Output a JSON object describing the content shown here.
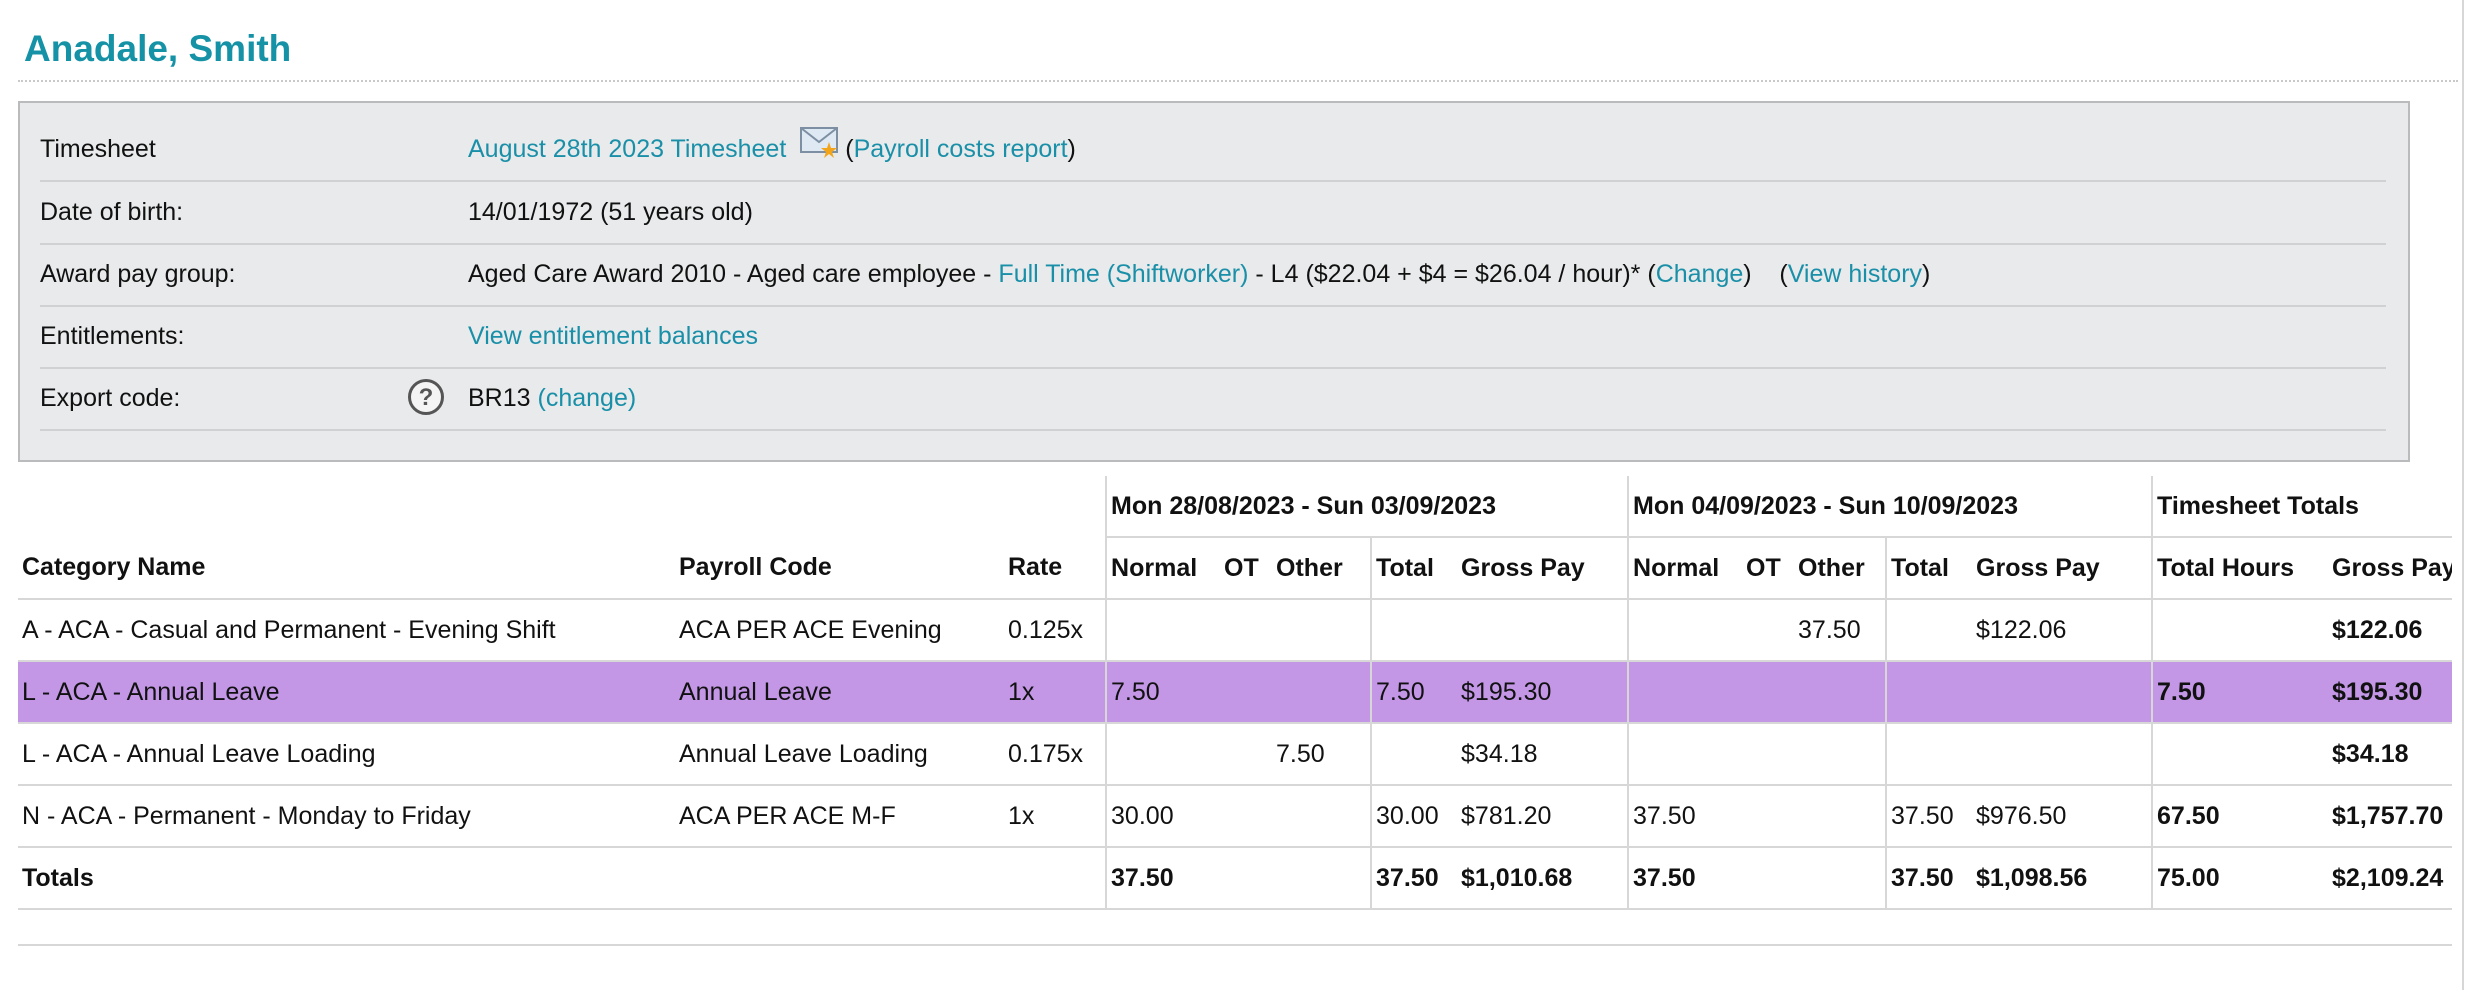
{
  "employee": {
    "name": "Anadale, Smith"
  },
  "info": {
    "timesheet": {
      "label": "Timesheet",
      "link": "August 28th 2023 Timesheet",
      "paren_open": "(",
      "report_link": "Payroll costs report",
      "paren_close": ")"
    },
    "dob": {
      "label": "Date of birth:",
      "value": "14/01/1972 (51 years old)"
    },
    "award": {
      "label": "Award pay group:",
      "prefix": "Aged Care Award 2010 - Aged care employee - ",
      "employment_link": "Full Time (Shiftworker)",
      "middle": " - L4 ($22.04 + $4 = $26.04 / hour)* (",
      "change_link": "Change",
      "sep": ")    (",
      "history_link": "View history",
      "end": ")"
    },
    "entitlements": {
      "label": "Entitlements:",
      "link": "View entitlement balances"
    },
    "export": {
      "label": "Export code:",
      "help_icon": "question-circle-icon",
      "code": "BR13",
      "change_link": "(change)"
    }
  },
  "table": {
    "week1_title": "Mon 28/08/2023 - Sun 03/09/2023",
    "week2_title": "Mon 04/09/2023 - Sun 10/09/2023",
    "totals_title": "Timesheet Totals",
    "headers": {
      "category": "Category Name",
      "payroll_code": "Payroll Code",
      "rate": "Rate",
      "normal": "Normal",
      "ot": "OT",
      "other": "Other",
      "total": "Total",
      "gross_pay": "Gross Pay",
      "total_hours": "Total Hours"
    },
    "rows": [
      {
        "category": "A - ACA - Casual and Permanent - Evening Shift",
        "code": "ACA PER ACE Evening",
        "rate": "0.125x",
        "w1_normal": "",
        "w1_ot": "",
        "w1_other": "",
        "w1_total": "",
        "w1_gross": "",
        "w2_normal": "",
        "w2_ot": "",
        "w2_other": "37.50",
        "w2_total": "",
        "w2_gross": "$122.06",
        "tot_hours": "",
        "tot_gross": "$122.06",
        "highlighted": false
      },
      {
        "category": "L - ACA - Annual Leave",
        "code": "Annual Leave",
        "rate": "1x",
        "w1_normal": "7.50",
        "w1_ot": "",
        "w1_other": "",
        "w1_total": "7.50",
        "w1_gross": "$195.30",
        "w2_normal": "",
        "w2_ot": "",
        "w2_other": "",
        "w2_total": "",
        "w2_gross": "",
        "tot_hours": "7.50",
        "tot_gross": "$195.30",
        "highlighted": true
      },
      {
        "category": "L - ACA - Annual Leave Loading",
        "code": "Annual Leave Loading",
        "rate": "0.175x",
        "w1_normal": "",
        "w1_ot": "",
        "w1_other": "7.50",
        "w1_total": "",
        "w1_gross": "$34.18",
        "w2_normal": "",
        "w2_ot": "",
        "w2_other": "",
        "w2_total": "",
        "w2_gross": "",
        "tot_hours": "",
        "tot_gross": "$34.18",
        "highlighted": false
      },
      {
        "category": "N - ACA - Permanent - Monday to Friday",
        "code": "ACA PER ACE M-F",
        "rate": "1x",
        "w1_normal": "30.00",
        "w1_ot": "",
        "w1_other": "",
        "w1_total": "30.00",
        "w1_gross": "$781.20",
        "w2_normal": "37.50",
        "w2_ot": "",
        "w2_other": "",
        "w2_total": "37.50",
        "w2_gross": "$976.50",
        "tot_hours": "67.50",
        "tot_gross": "$1,757.70",
        "highlighted": false
      }
    ],
    "totals": {
      "label": "Totals",
      "w1_normal": "37.50",
      "w1_total": "37.50",
      "w1_gross": "$1,010.68",
      "w2_normal": "37.50",
      "w2_total": "37.50",
      "w2_gross": "$1,098.56",
      "tot_hours": "75.00",
      "tot_gross": "$2,109.24"
    }
  },
  "colors": {
    "title": "#1592a6",
    "link": "#1a8fa8",
    "highlight_row": "#c397e6",
    "panel_bg": "#e8eaeb"
  }
}
